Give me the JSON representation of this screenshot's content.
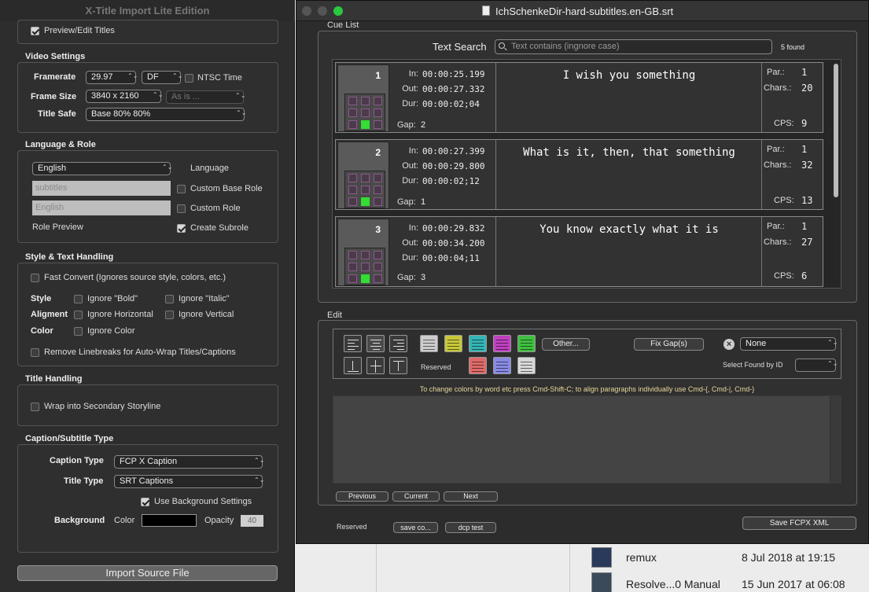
{
  "left_panel": {
    "title": "X-Title Import Lite Edition",
    "preview_edit_titles": "Preview/Edit Titles",
    "video_settings": {
      "header": "Video Settings",
      "framerate_label": "Framerate",
      "framerate_value": "29.97",
      "df_value": "DF",
      "ntsc_time": "NTSC Time",
      "frame_size_label": "Frame Size",
      "frame_size_value": "3840 x 2160",
      "as_is_value": "As is ...",
      "title_safe_label": "Title Safe",
      "title_safe_value": "Base 80% 80%"
    },
    "language_role": {
      "header": "Language & Role",
      "language_value": "English",
      "language_label": "Language",
      "base_role_field": "subtitles",
      "custom_base_role": "Custom Base Role",
      "role_field": "English",
      "custom_role": "Custom Role",
      "role_preview": "Role Preview",
      "create_subrole": "Create Subrole"
    },
    "style_text": {
      "header": "Style & Text Handling",
      "fast_convert": "Fast Convert (Ignores source style, colors, etc.)",
      "style_label": "Style",
      "ignore_bold": "Ignore \"Bold\"",
      "ignore_italic": "Ignore \"Italic\"",
      "alignment_label": "Aligment",
      "ignore_horizontal": "Ignore Horizontal",
      "ignore_vertical": "Ignore Vertical",
      "color_label": "Color",
      "ignore_color": "Ignore Color",
      "remove_linebreaks": "Remove Linebreaks for Auto-Wrap Titles/Captions"
    },
    "title_handling": {
      "header": "Title Handling",
      "wrap_secondary": "Wrap into Secondary Storyline"
    },
    "caption_type": {
      "header": "Caption/Subtitle Type",
      "caption_type_label": "Caption Type",
      "caption_type_value": "FCP X Caption",
      "title_type_label": "Title Type",
      "title_type_value": "SRT Captions",
      "use_background": "Use Background Settings",
      "background_label": "Background",
      "color_label": "Color",
      "opacity_label": "Opacity",
      "opacity_value": "40"
    },
    "import_button": "Import Source File"
  },
  "main_window": {
    "file_title": "IchSchenkeDir-hard-subtitles.en-GB.srt",
    "cue_list_label": "Cue List",
    "text_search_label": "Text Search",
    "search_placeholder": "Text contains (ingnore case)",
    "found_count": "5  found",
    "cues": [
      {
        "num": "1",
        "in_label": "In:",
        "in": "00:00:25.199",
        "out_label": "Out:",
        "out": "00:00:27.332",
        "dur_label": "Dur:",
        "dur": "00:00:02;04",
        "gap_label": "Gap:",
        "gap": "2",
        "text": "I wish you something",
        "par_label": "Par.:",
        "par": "1",
        "chars_label": "Chars.:",
        "chars": "20",
        "cps_label": "CPS:",
        "cps": "9"
      },
      {
        "num": "2",
        "in_label": "In:",
        "in": "00:00:27.399",
        "out_label": "Out:",
        "out": "00:00:29.800",
        "dur_label": "Dur:",
        "dur": "00:00:02;12",
        "gap_label": "Gap:",
        "gap": "1",
        "text": "What is it, then, that something",
        "par_label": "Par.:",
        "par": "1",
        "chars_label": "Chars.:",
        "chars": "32",
        "cps_label": "CPS:",
        "cps": "13"
      },
      {
        "num": "3",
        "in_label": "In:",
        "in": "00:00:29.832",
        "out_label": "Out:",
        "out": "00:00:34.200",
        "dur_label": "Dur:",
        "dur": "00:00:04;11",
        "gap_label": "Gap:",
        "gap": "3",
        "text": "You know exactly what it is",
        "par_label": "Par.:",
        "par": "1",
        "chars_label": "Chars.:",
        "chars": "27",
        "cps_label": "CPS:",
        "cps": "6"
      }
    ],
    "edit_label": "Edit",
    "other_button": "Other...",
    "fix_gaps_button": "Fix Gap(s)",
    "none_value": "None",
    "reserved_label": "Reserved",
    "select_found_label": "Select Found by ID",
    "hint_text": "To change colors by word etc press Cmd-Shift-C; to align paragraphs individually use Cmd-{, Cmd-|, Cmd-}",
    "previous_button": "Previous",
    "current_button": "Current",
    "next_button": "Next",
    "bottom_reserved": "Reserved",
    "save_co_button": "save co...",
    "dcp_test_button": "dcp test",
    "save_fcpx_button": "Save FCPX XML",
    "swatch_colors": [
      "#cccccc",
      "#c8c83a",
      "#35b5b5",
      "#c040c0",
      "#40c040",
      "#e06a6a",
      "#8a8ae6",
      "#d8d8d8"
    ]
  },
  "desktop": {
    "files": [
      {
        "name": "remux",
        "date": "8 Jul 2018 at 19:15"
      },
      {
        "name": "Resolve...0 Manual",
        "date": "15 Jun 2017 at 06:08"
      }
    ]
  }
}
